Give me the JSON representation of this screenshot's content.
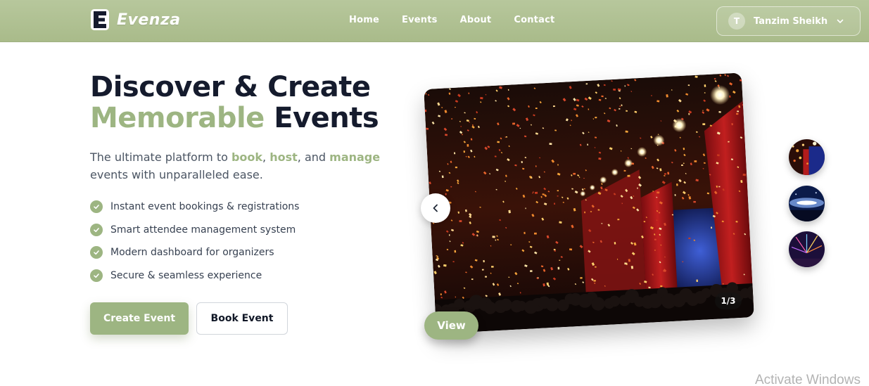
{
  "brand": {
    "name": "Evenza",
    "logo_icon": "e-logo-icon"
  },
  "nav": {
    "links": [
      {
        "label": "Home"
      },
      {
        "label": "Events"
      },
      {
        "label": "About"
      },
      {
        "label": "Contact"
      }
    ]
  },
  "user": {
    "initial": "T",
    "name": "Tanzim Sheikh"
  },
  "hero": {
    "headline_line1": "Discover & Create",
    "headline_accent": "Memorable",
    "headline_rest": " Events",
    "subtitle": {
      "pre": "The ultimate platform to ",
      "book": "book",
      "sep1": ", ",
      "host": "host",
      "sep2": ", and ",
      "manage": "manage",
      "post": " events with unparalleled ease."
    },
    "features": [
      "Instant event bookings & registrations",
      "Smart attendee management system",
      "Modern dashboard for organizers",
      "Secure & seamless experience"
    ],
    "primary_button": "Create Event",
    "secondary_button": "Book Event"
  },
  "carousel": {
    "counter": "1/3",
    "view_button": "View",
    "current_slide": 1,
    "total_slides": 3
  },
  "colors": {
    "accent": "#9db582",
    "navbar": "#b0c293",
    "heading": "#151b2d"
  },
  "watermark": "Activate Windows"
}
